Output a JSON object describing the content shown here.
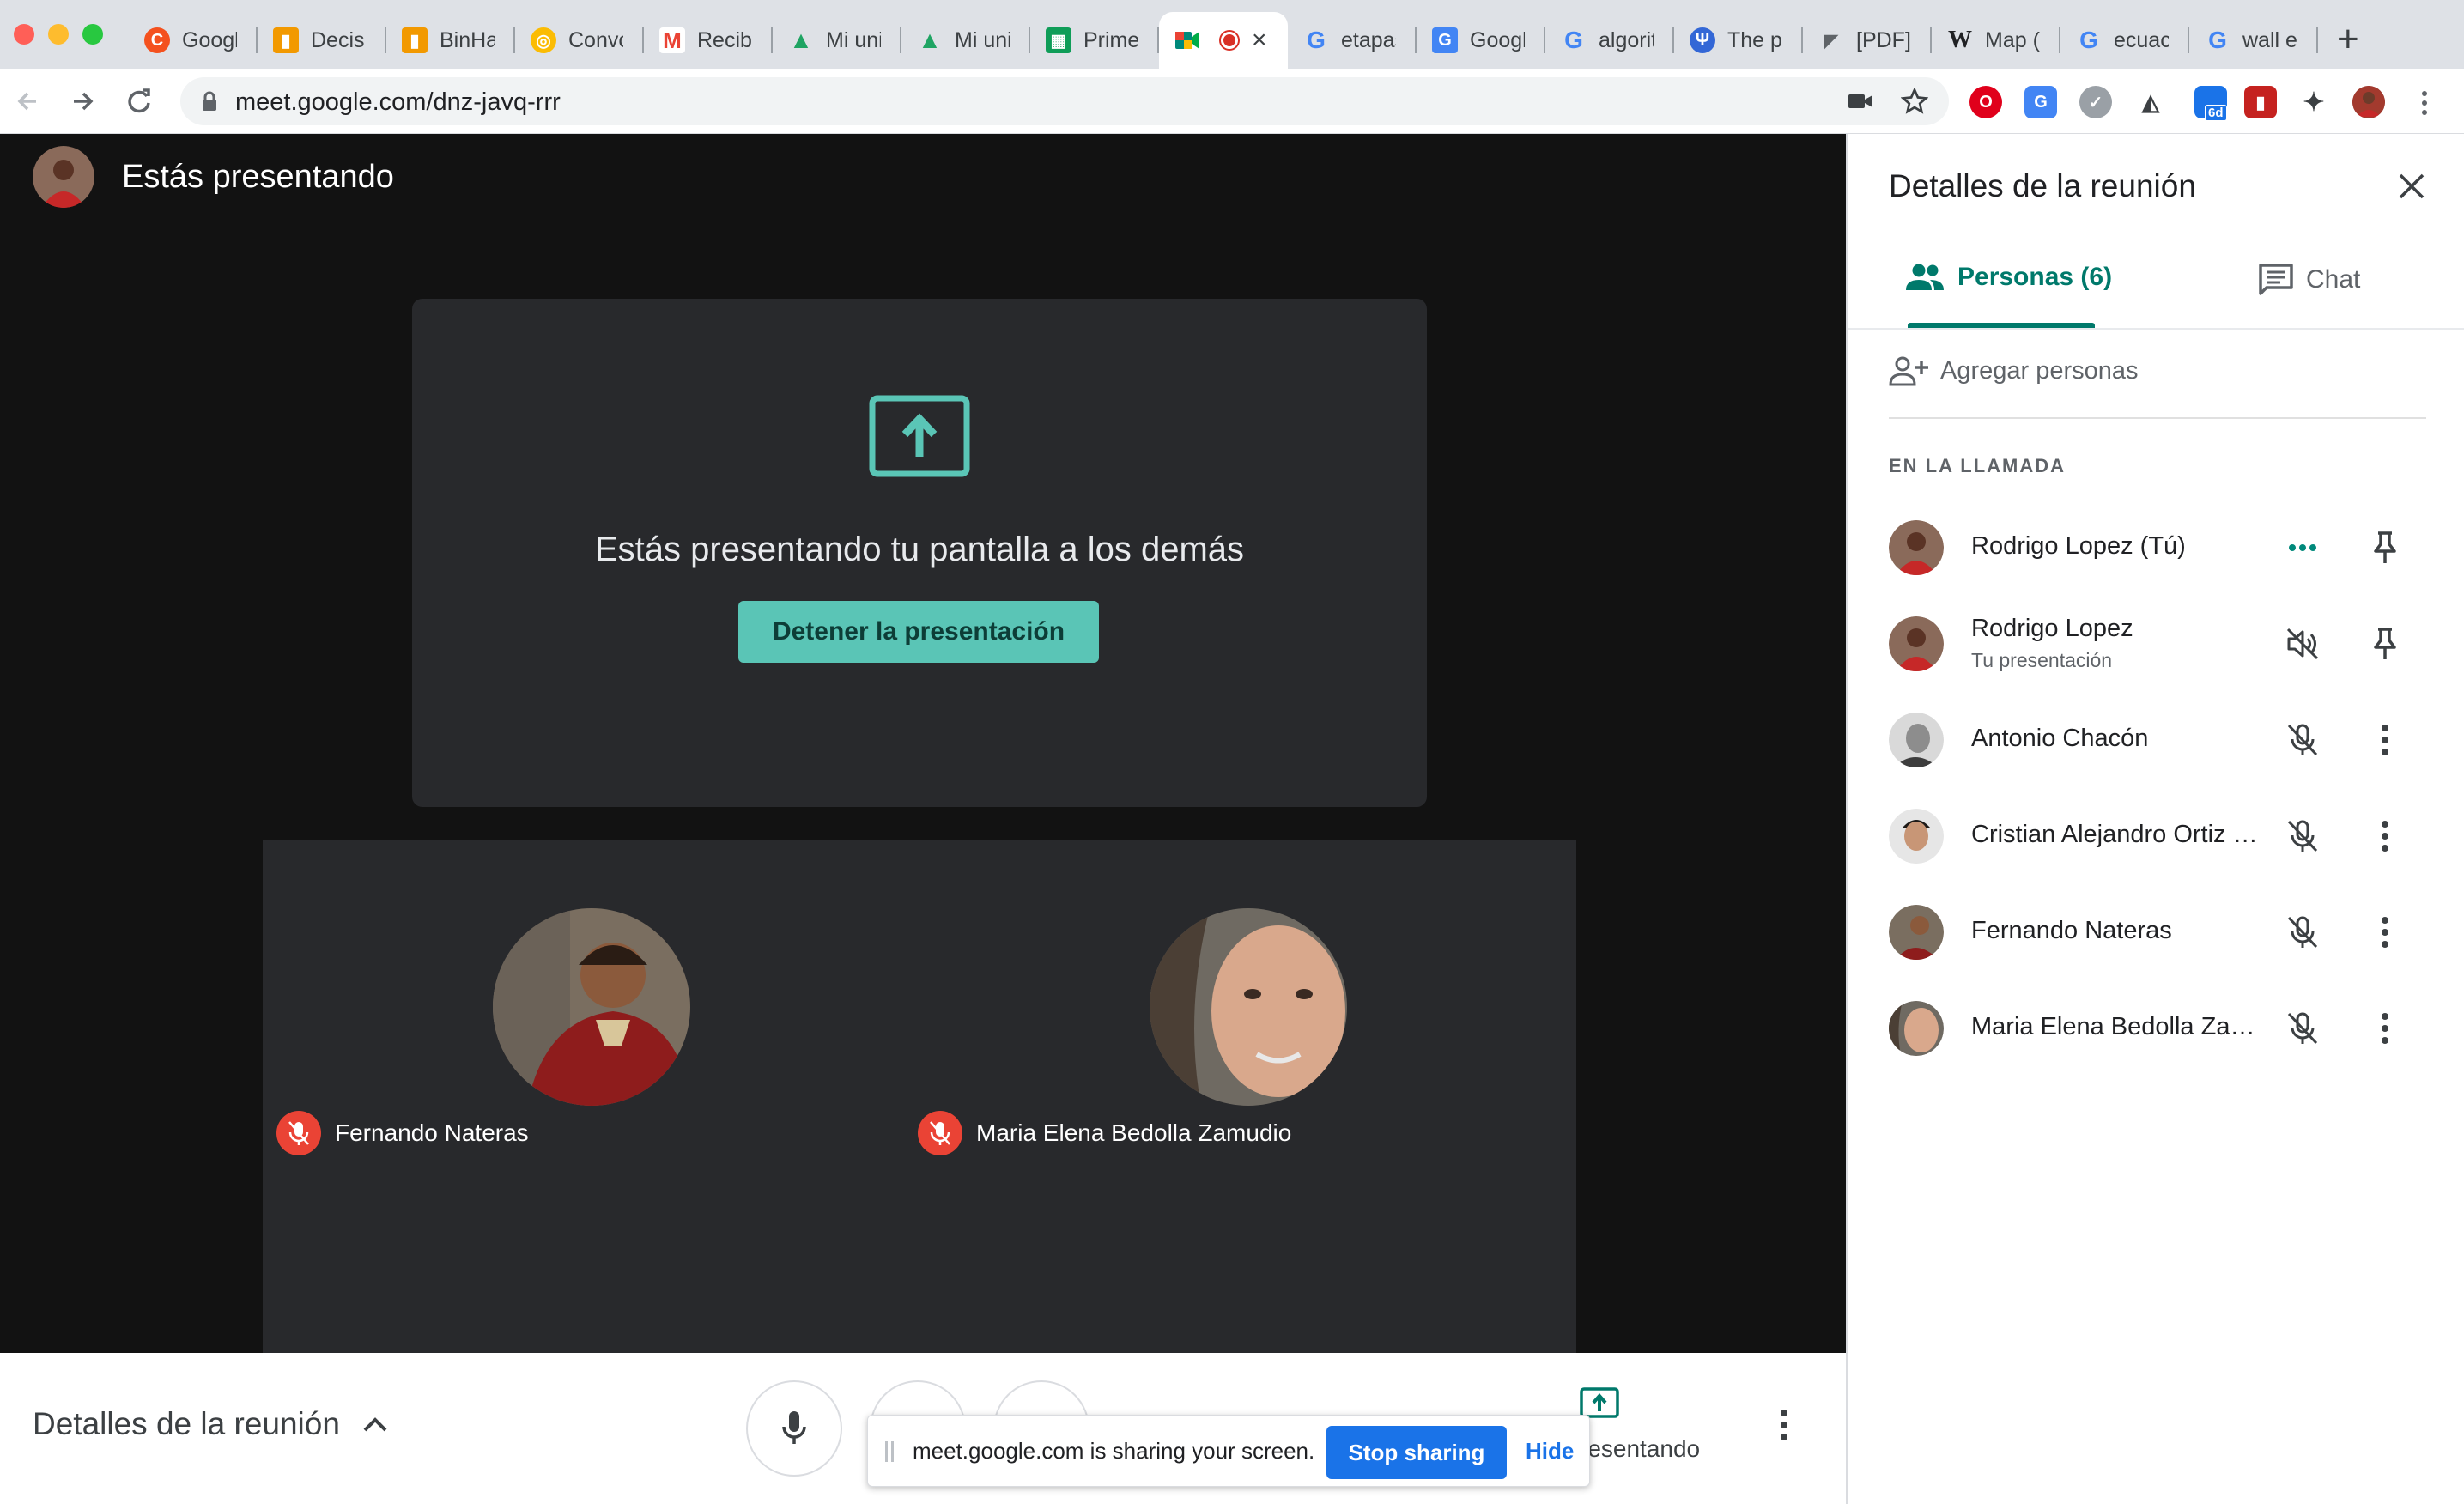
{
  "browser": {
    "tabs": [
      {
        "title": "Googl",
        "favicon": "google-orange-icon",
        "color": "#f4511e"
      },
      {
        "title": "Decisi",
        "favicon": "book-icon",
        "color": "#f29900"
      },
      {
        "title": "BinHa",
        "favicon": "book-icon",
        "color": "#f29900"
      },
      {
        "title": "Convo",
        "favicon": "coin-icon",
        "color": "#fbbc04"
      },
      {
        "title": "Recibi",
        "favicon": "gmail-icon",
        "color": "#ea4335"
      },
      {
        "title": "Mi uni",
        "favicon": "drive-icon",
        "color": "#1fa463"
      },
      {
        "title": "Mi uni",
        "favicon": "drive-icon",
        "color": "#1fa463"
      },
      {
        "title": "Primer",
        "favicon": "sheets-icon",
        "color": "#0f9d58"
      },
      {
        "title": "",
        "favicon": "meet-icon",
        "color": "#00897b",
        "active": true
      },
      {
        "title": "etapas",
        "favicon": "google-icon",
        "color": "#4285f4"
      },
      {
        "title": "Googl",
        "favicon": "translate-icon",
        "color": "#4285f4"
      },
      {
        "title": "algorit",
        "favicon": "google-icon",
        "color": "#4285f4"
      },
      {
        "title": "The p",
        "favicon": "globe-icon",
        "color": "#3367d6"
      },
      {
        "title": "[PDF]",
        "favicon": "pdf-icon",
        "color": "#5f6368"
      },
      {
        "title": "Map (",
        "favicon": "wikipedia-icon",
        "color": "#202124"
      },
      {
        "title": "ecuac",
        "favicon": "google-icon",
        "color": "#4285f4"
      },
      {
        "title": "wall e",
        "favicon": "google-icon",
        "color": "#4285f4"
      }
    ],
    "new_tab": "+",
    "url": "meet.google.com/dnz-javq-rrr",
    "extension_badge": "6d"
  },
  "meet": {
    "header_label": "Estás presentando",
    "present_message": "Estás presentando tu pantalla a los demás",
    "stop_presenting_label": "Detener la presentación",
    "tiles": [
      {
        "name": "Fernando Nateras",
        "muted": true
      },
      {
        "name": "Maria Elena Bedolla Zamudio",
        "muted": true
      },
      {
        "name": "",
        "muted": false
      },
      {
        "name": "",
        "muted": false
      }
    ],
    "bottom": {
      "details_label": "Detalles de la reunión",
      "presenting_label": "resentando"
    },
    "share_notice": {
      "text": "meet.google.com is sharing your screen.",
      "stop_label": "Stop sharing",
      "hide_label": "Hide"
    }
  },
  "panel": {
    "title": "Detalles de la reunión",
    "tab_people": "Personas (6)",
    "tab_chat": "Chat",
    "add_people": "Agregar personas",
    "section_label": "EN LA LLAMADA",
    "participants": [
      {
        "name": "Rodrigo Lopez (Tú)",
        "sub": "",
        "status": "speaking",
        "action": "pin"
      },
      {
        "name": "Rodrigo Lopez",
        "sub": "Tu presentación",
        "status": "volume-off",
        "action": "pin"
      },
      {
        "name": "Antonio Chacón",
        "sub": "",
        "status": "mic-off",
        "action": "more"
      },
      {
        "name": "Cristian Alejandro Ortiz L...",
        "sub": "",
        "status": "mic-off",
        "action": "more"
      },
      {
        "name": "Fernando Nateras",
        "sub": "",
        "status": "mic-off",
        "action": "more"
      },
      {
        "name": "Maria Elena Bedolla Zam...",
        "sub": "",
        "status": "mic-off",
        "action": "more"
      }
    ]
  },
  "colors": {
    "accent": "#00796b",
    "stop_button": "#5ac5b6",
    "mute_badge": "#ea4335",
    "share_stop": "#1a73e8"
  }
}
